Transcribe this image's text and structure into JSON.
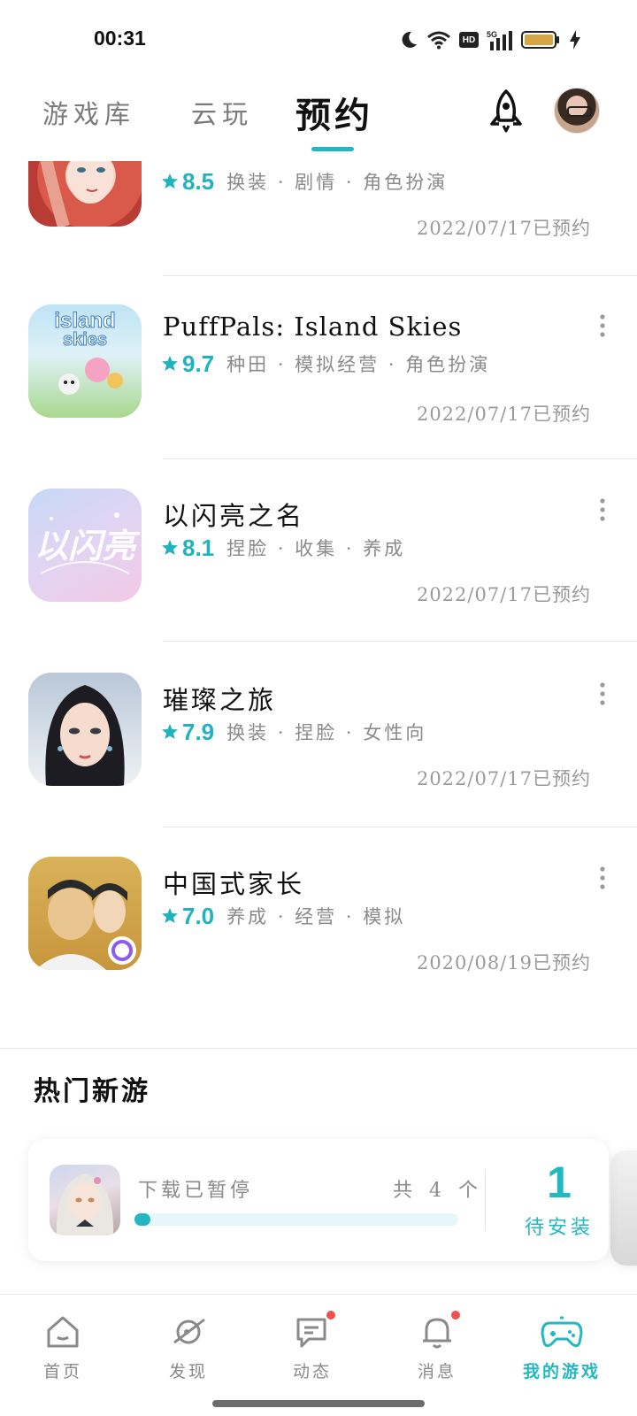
{
  "status_bar": {
    "time": "00:31",
    "network": "5G",
    "hd": "HD"
  },
  "top_nav": {
    "tabs": [
      {
        "label": "游戏库",
        "active": false
      },
      {
        "label": "云玩",
        "active": false
      },
      {
        "label": "预约",
        "active": true
      }
    ]
  },
  "reservations": [
    {
      "name": "",
      "rating": "8.5",
      "tags": "换装 · 剧情 · 角色扮演",
      "reserved": "2022/07/17已预约",
      "icon": "anime-girl-red-hair"
    },
    {
      "name": "PuffPals: Island Skies",
      "rating": "9.7",
      "tags": "种田 · 模拟经营 · 角色扮演",
      "reserved": "2022/07/17已预约",
      "icon": "puffpals-island"
    },
    {
      "name": "以闪亮之名",
      "rating": "8.1",
      "tags": "捏脸 · 收集 · 养成",
      "reserved": "2022/07/17已预约",
      "icon": "shining-name-logo"
    },
    {
      "name": "璀璨之旅",
      "rating": "7.9",
      "tags": "换装 · 捏脸 · 女性向",
      "reserved": "2022/07/17已预约",
      "icon": "traditional-lady"
    },
    {
      "name": "中国式家长",
      "rating": "7.0",
      "tags": "养成 · 经营 · 模拟",
      "reserved": "2020/08/19已预约",
      "icon": "chinese-parents"
    }
  ],
  "section": {
    "title": "热门新游"
  },
  "download_card": {
    "status": "下载已暂停",
    "count": "共 4 个",
    "progress": 0.05,
    "pending_count": "1",
    "pending_label": "待安装"
  },
  "bottom_nav": [
    {
      "label": "首页",
      "icon": "home-icon",
      "badge": false
    },
    {
      "label": "发现",
      "icon": "planet-icon",
      "badge": false
    },
    {
      "label": "动态",
      "icon": "chat-icon",
      "badge": true
    },
    {
      "label": "消息",
      "icon": "bell-icon",
      "badge": true
    },
    {
      "label": "我的游戏",
      "icon": "gamepad-icon",
      "badge": false,
      "active": true
    }
  ],
  "colors": {
    "accent": "#22b8c3",
    "badge": "#f05050"
  }
}
